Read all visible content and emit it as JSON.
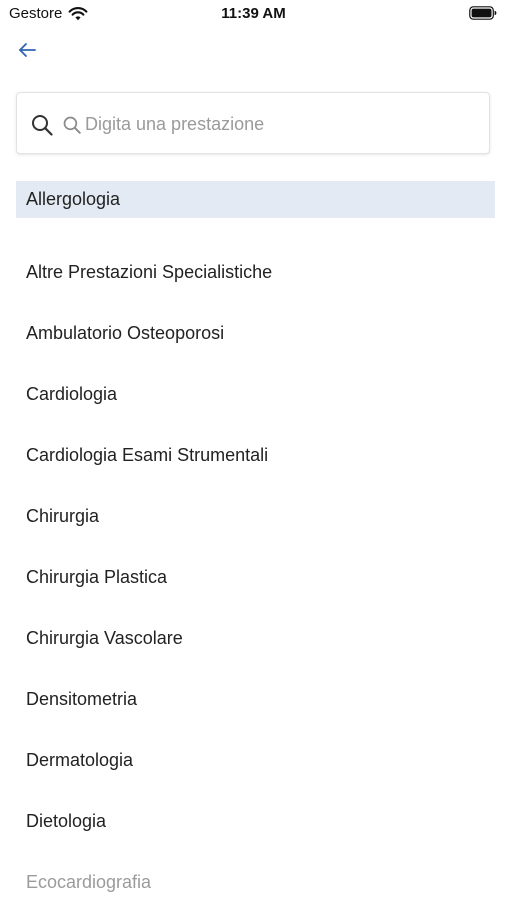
{
  "status_bar": {
    "carrier": "Gestore",
    "time": "11:39 AM"
  },
  "colors": {
    "accent": "#2f64b4",
    "selected_row": "#e3eaf3"
  },
  "search": {
    "placeholder": "Digita una prestazione",
    "value": ""
  },
  "specialties": [
    "Allergologia",
    "Altre Prestazioni Specialistiche",
    "Ambulatorio Osteoporosi",
    "Cardiologia",
    "Cardiologia Esami Strumentali",
    "Chirurgia",
    "Chirurgia Plastica",
    "Chirurgia Vascolare",
    "Densitometria",
    "Dermatologia",
    "Dietologia",
    "Ecocardiografia"
  ],
  "icons": {
    "back": "arrow-left-icon",
    "search": "magnifier-icon",
    "wifi": "wifi-icon",
    "battery": "battery-icon"
  }
}
